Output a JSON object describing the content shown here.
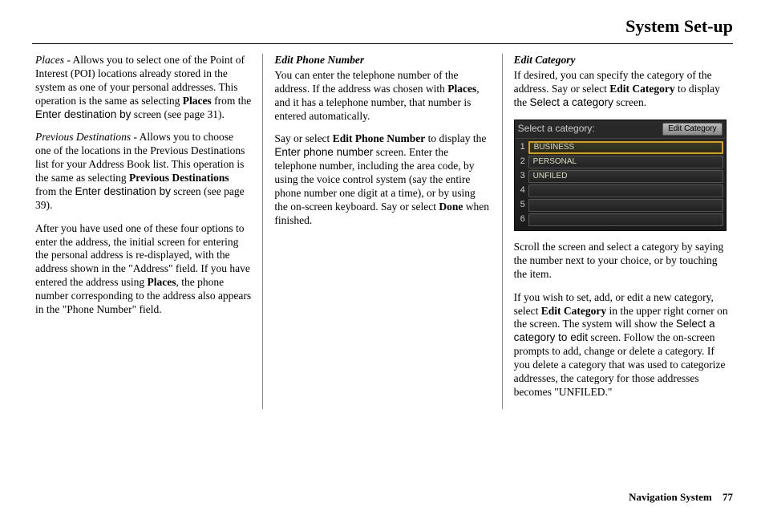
{
  "header": "System Set-up",
  "col1": {
    "p1_a": "Places",
    "p1_b": " - Allows you to select one of the Point of Interest (POI) locations already stored in the system as one of your personal addresses. This operation is the same as selecting ",
    "p1_c": "Places",
    "p1_d": " from the ",
    "p1_e": "Enter destination by",
    "p1_f": " screen (see page 31).",
    "p2_a": "Previous Destinations",
    "p2_b": " - Allows you to choose one of the locations in the Previous Destinations list for your Address Book list. This operation is the same as selecting ",
    "p2_c": "Previous Destinations",
    "p2_d": " from the ",
    "p2_e": "Enter destination by",
    "p2_f": " screen (see page 39).",
    "p3_a": "After you have used one of these four options to enter the address, the initial screen for entering the personal address is re-displayed, with the address shown in the \"Address\" field. If you have entered the address using ",
    "p3_b": "Places",
    "p3_c": ", the phone number corresponding to the address also appears in the \"Phone Number\" field."
  },
  "col2": {
    "heading": "Edit Phone Number",
    "p1_a": "You can enter the telephone number of the address. If the address was chosen with ",
    "p1_b": "Places",
    "p1_c": ", and it has a telephone number, that number is entered automatically.",
    "p2_a": "Say or select ",
    "p2_b": "Edit Phone Number",
    "p2_c": " to display the ",
    "p2_d": "Enter phone number",
    "p2_e": " screen. Enter the telephone number, including the area code, by using the voice control system (say the entire phone number one digit at a time), or by using the on-screen keyboard. Say or select ",
    "p2_f": "Done",
    "p2_g": " when finished."
  },
  "col3": {
    "heading": "Edit Category",
    "p1_a": "If desired, you can specify the category of the address. Say or select ",
    "p1_b": "Edit Category",
    "p1_c": " to display the ",
    "p1_d": "Select a category",
    "p1_e": " screen.",
    "p2": "Scroll the screen and select a category by saying the number next to your choice, or by touching the item.",
    "p3_a": "If you wish to set, add, or edit a new category, select ",
    "p3_b": "Edit Category",
    "p3_c": " in the upper right corner on the screen. The system will show the ",
    "p3_d": "Select a category to edit",
    "p3_e": " screen. Follow the on-screen prompts to add, change or delete a category. If you delete a category that was used to categorize addresses, the category for those addresses becomes \"UNFILED.\""
  },
  "screenshot": {
    "title": "Select a category:",
    "button": "Edit Category",
    "rows": [
      {
        "n": "1",
        "label": "BUSINESS",
        "selected": true
      },
      {
        "n": "2",
        "label": "PERSONAL",
        "selected": false
      },
      {
        "n": "3",
        "label": "UNFILED",
        "selected": false
      },
      {
        "n": "4",
        "label": "",
        "selected": false
      },
      {
        "n": "5",
        "label": "",
        "selected": false
      },
      {
        "n": "6",
        "label": "",
        "selected": false
      }
    ]
  },
  "footer": {
    "label": "Navigation System",
    "num": "77"
  }
}
